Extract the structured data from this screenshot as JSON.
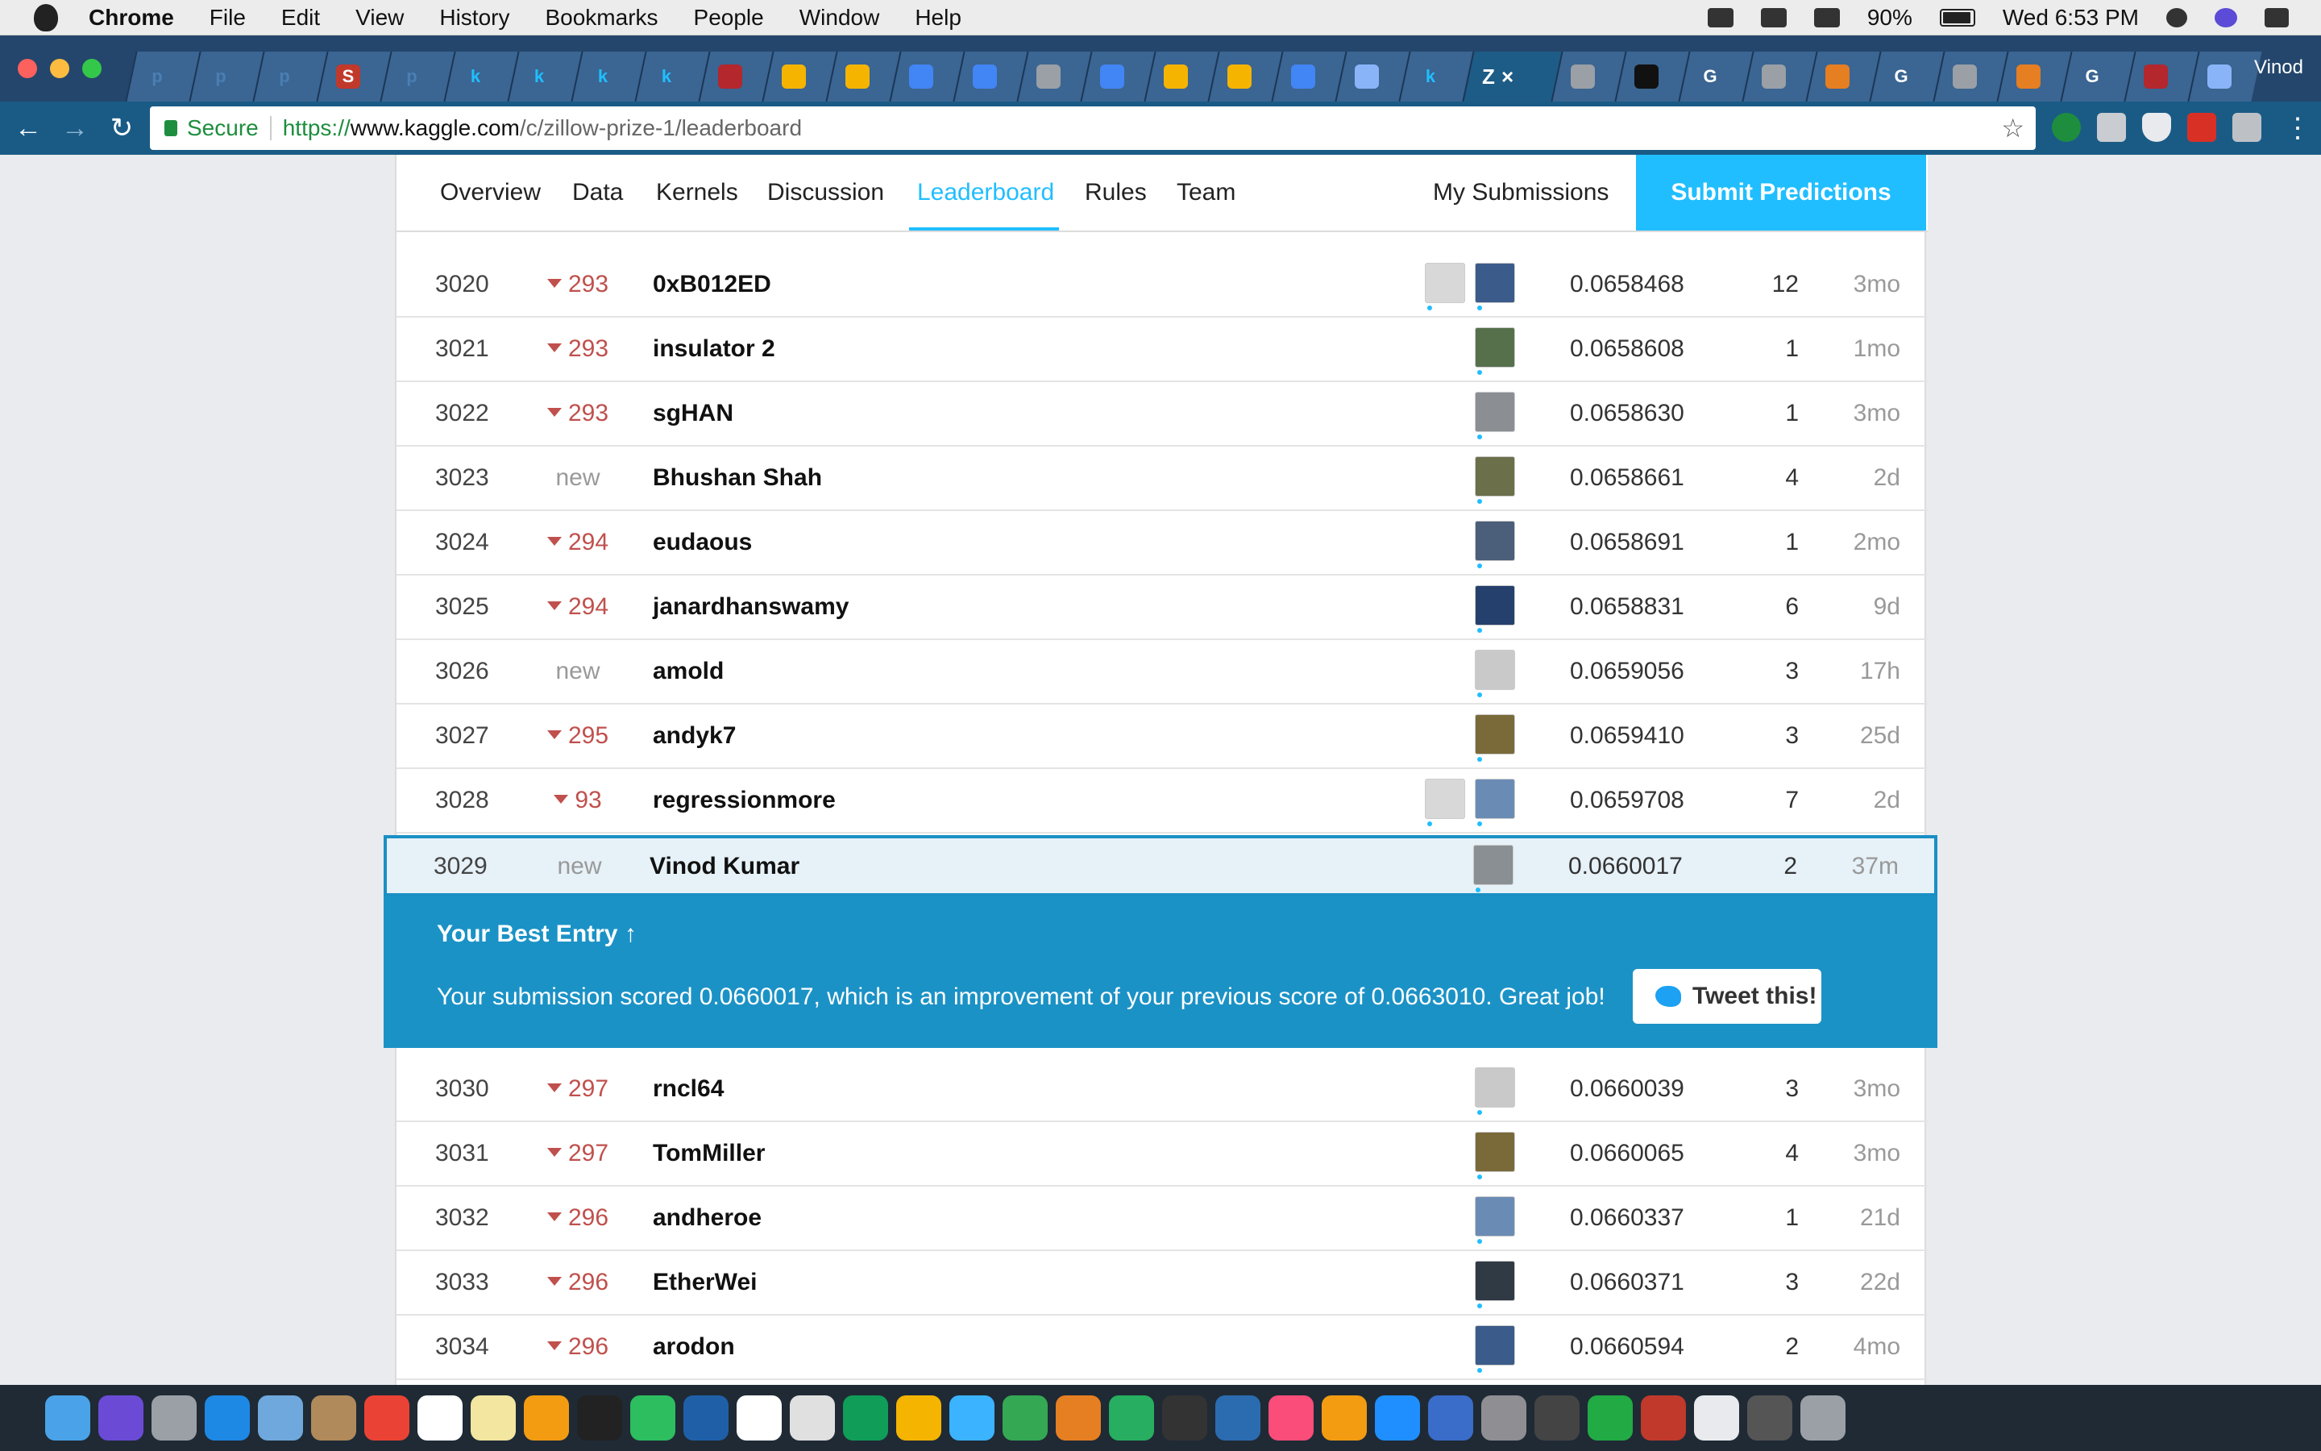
{
  "menubar": {
    "app_name": "Chrome",
    "menus": [
      "File",
      "Edit",
      "View",
      "History",
      "Bookmarks",
      "People",
      "Window",
      "Help"
    ],
    "battery": "90%",
    "clock": "Wed 6:53 PM"
  },
  "browser": {
    "profile_name": "Vinod",
    "active_tab_label": "Z",
    "tab_favicons": [
      {
        "glyph": "p",
        "color": "#4a7fb5"
      },
      {
        "glyph": "p",
        "color": "#4a7fb5"
      },
      {
        "glyph": "p",
        "color": "#4a7fb5"
      },
      {
        "glyph": "S",
        "color": "#c0392b"
      },
      {
        "glyph": "p",
        "color": "#4a7fb5"
      },
      {
        "glyph": "k",
        "color": "#20beff"
      },
      {
        "glyph": "k",
        "color": "#20beff"
      },
      {
        "glyph": "k",
        "color": "#20beff"
      },
      {
        "glyph": "k",
        "color": "#20beff"
      },
      {
        "glyph": "",
        "color": "#b3272d"
      },
      {
        "glyph": "",
        "color": "#f4b400"
      },
      {
        "glyph": "",
        "color": "#f4b400"
      },
      {
        "glyph": "",
        "color": "#4285f4"
      },
      {
        "glyph": "",
        "color": "#4285f4"
      },
      {
        "glyph": "",
        "color": "#9aa0a6"
      },
      {
        "glyph": "",
        "color": "#4285f4"
      },
      {
        "glyph": "",
        "color": "#f4b400"
      },
      {
        "glyph": "",
        "color": "#f4b400"
      },
      {
        "glyph": "",
        "color": "#4285f4"
      },
      {
        "glyph": "",
        "color": "#8ab4f8"
      },
      {
        "glyph": "k",
        "color": "#20beff"
      }
    ],
    "tab_favicons_after": [
      {
        "glyph": "",
        "color": "#9aa0a6"
      },
      {
        "glyph": "",
        "color": "#111111"
      },
      {
        "glyph": "G",
        "color": "#ffffff"
      },
      {
        "glyph": "",
        "color": "#9aa0a6"
      },
      {
        "glyph": "",
        "color": "#e67e22"
      },
      {
        "glyph": "G",
        "color": "#ffffff"
      },
      {
        "glyph": "",
        "color": "#9aa0a6"
      },
      {
        "glyph": "",
        "color": "#e67e22"
      },
      {
        "glyph": "G",
        "color": "#ffffff"
      },
      {
        "glyph": "",
        "color": "#b3272d"
      },
      {
        "glyph": "",
        "color": "#8ab4f8"
      }
    ],
    "omnibox": {
      "secure_label": "Secure",
      "scheme": "https://",
      "host": "www.kaggle.com",
      "path": "/c/zillow-prize-1/leaderboard"
    }
  },
  "competition_nav": {
    "tabs": [
      "Overview",
      "Data",
      "Kernels",
      "Discussion",
      "Leaderboard",
      "Rules",
      "Team"
    ],
    "active_tab": "Leaderboard",
    "my_submissions": "My Submissions",
    "submit_button": "Submit Predictions"
  },
  "leaderboard_rows_top": [
    {
      "rank": "3020",
      "delta": "293",
      "is_new": false,
      "team": "0xB012ED",
      "score": "0.0658468",
      "entries": "12",
      "last": "3mo",
      "avatars": 2
    },
    {
      "rank": "3021",
      "delta": "293",
      "is_new": false,
      "team": "insulator 2",
      "score": "0.0658608",
      "entries": "1",
      "last": "1mo",
      "avatars": 1
    },
    {
      "rank": "3022",
      "delta": "293",
      "is_new": false,
      "team": "sgHAN",
      "score": "0.0658630",
      "entries": "1",
      "last": "3mo",
      "avatars": 1
    },
    {
      "rank": "3023",
      "delta": "new",
      "is_new": true,
      "team": "Bhushan Shah",
      "score": "0.0658661",
      "entries": "4",
      "last": "2d",
      "avatars": 1
    },
    {
      "rank": "3024",
      "delta": "294",
      "is_new": false,
      "team": "eudaous",
      "score": "0.0658691",
      "entries": "1",
      "last": "2mo",
      "avatars": 1
    },
    {
      "rank": "3025",
      "delta": "294",
      "is_new": false,
      "team": "janardhanswamy",
      "score": "0.0658831",
      "entries": "6",
      "last": "9d",
      "avatars": 1
    },
    {
      "rank": "3026",
      "delta": "new",
      "is_new": true,
      "team": "amold",
      "score": "0.0659056",
      "entries": "3",
      "last": "17h",
      "avatars": 1
    },
    {
      "rank": "3027",
      "delta": "295",
      "is_new": false,
      "team": "andyk7",
      "score": "0.0659410",
      "entries": "3",
      "last": "25d",
      "avatars": 1
    },
    {
      "rank": "3028",
      "delta": "93",
      "is_new": false,
      "team": "regressionmore",
      "score": "0.0659708",
      "entries": "7",
      "last": "2d",
      "avatars": 2
    }
  ],
  "my_row": {
    "rank": "3029",
    "delta": "new",
    "team": "Vinod Kumar",
    "score": "0.0660017",
    "entries": "2",
    "last": "37m"
  },
  "best_entry": {
    "title": "Your Best Entry ↑",
    "message": "Your submission scored 0.0660017, which is an improvement of your previous score of 0.0663010. Great job!",
    "tweet_button": "Tweet this!"
  },
  "leaderboard_rows_bottom": [
    {
      "rank": "3030",
      "delta": "297",
      "is_new": false,
      "team": "rncl64",
      "score": "0.0660039",
      "entries": "3",
      "last": "3mo",
      "avatars": 1
    },
    {
      "rank": "3031",
      "delta": "297",
      "is_new": false,
      "team": "TomMiller",
      "score": "0.0660065",
      "entries": "4",
      "last": "3mo",
      "avatars": 1
    },
    {
      "rank": "3032",
      "delta": "296",
      "is_new": false,
      "team": "andheroe",
      "score": "0.0660337",
      "entries": "1",
      "last": "21d",
      "avatars": 1
    },
    {
      "rank": "3033",
      "delta": "296",
      "is_new": false,
      "team": "EtherWei",
      "score": "0.0660371",
      "entries": "3",
      "last": "22d",
      "avatars": 1
    },
    {
      "rank": "3034",
      "delta": "296",
      "is_new": false,
      "team": "arodon",
      "score": "0.0660594",
      "entries": "2",
      "last": "4mo",
      "avatars": 1
    }
  ],
  "colors": {
    "kaggle_blue": "#20beff",
    "best_entry_bg": "#1b92c6",
    "rank_down": "#c0504d",
    "chrome_toolbar": "#1a5b86"
  },
  "dock_icons": [
    "finder-icon",
    "siri-icon",
    "launchpad-icon",
    "safari-icon",
    "mail-icon",
    "contacts-icon",
    "chrome-icon",
    "calendar-icon",
    "notes-icon",
    "sublime-icon",
    "terminal-icon",
    "evernote-icon",
    "virtualbox-icon",
    "reminders-icon",
    "preview-icon",
    "google-drive-icon",
    "photos-icon",
    "messages-icon",
    "facetime-icon",
    "pages-icon",
    "numbers-icon",
    "dashboard-icon",
    "keynote-icon",
    "itunes-icon",
    "ibooks-icon",
    "app-store-icon",
    "r-icon",
    "system-preferences-icon",
    "help-icon",
    "activity-icon",
    "acrobat-icon",
    "document-icon",
    "window-thumbnail-icon",
    "trash-icon"
  ]
}
